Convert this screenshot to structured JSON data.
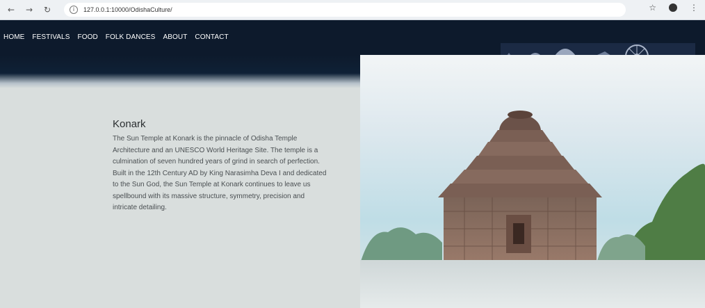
{
  "browser": {
    "url": "127.0.0.1:10000/OdishaCulture/"
  },
  "nav": {
    "items": [
      "HOME",
      "FESTIVALS",
      "FOOD",
      "FOLK DANCES",
      "ABOUT",
      "CONTACT"
    ]
  },
  "section": {
    "title": "Konark",
    "body": "The Sun Temple at Konark is the pinnacle of Odisha Temple Architecture and an UNESCO World Heritage Site. The temple is a culmination of seven hundred years of grind in search of perfection. Built in the 12th Century AD by King Narasimha Deva I and dedicated to the Sun God, the Sun Temple at Konark continues to leave us spellbound with its massive structure, symmetry, precision and intricate detailing."
  },
  "colors": {
    "header_bg": "#0d1a2c",
    "page_bg": "#d9dedd",
    "nav_text": "#ffffff",
    "title_text": "#2b2f31",
    "body_text": "#4a4f52"
  },
  "icons": {
    "back": "back-arrow-icon",
    "forward": "forward-arrow-icon",
    "reload": "reload-icon",
    "site_info": "info-icon",
    "bookmark": "star-icon",
    "profile": "profile-icon",
    "menu": "kebab-menu-icon"
  }
}
